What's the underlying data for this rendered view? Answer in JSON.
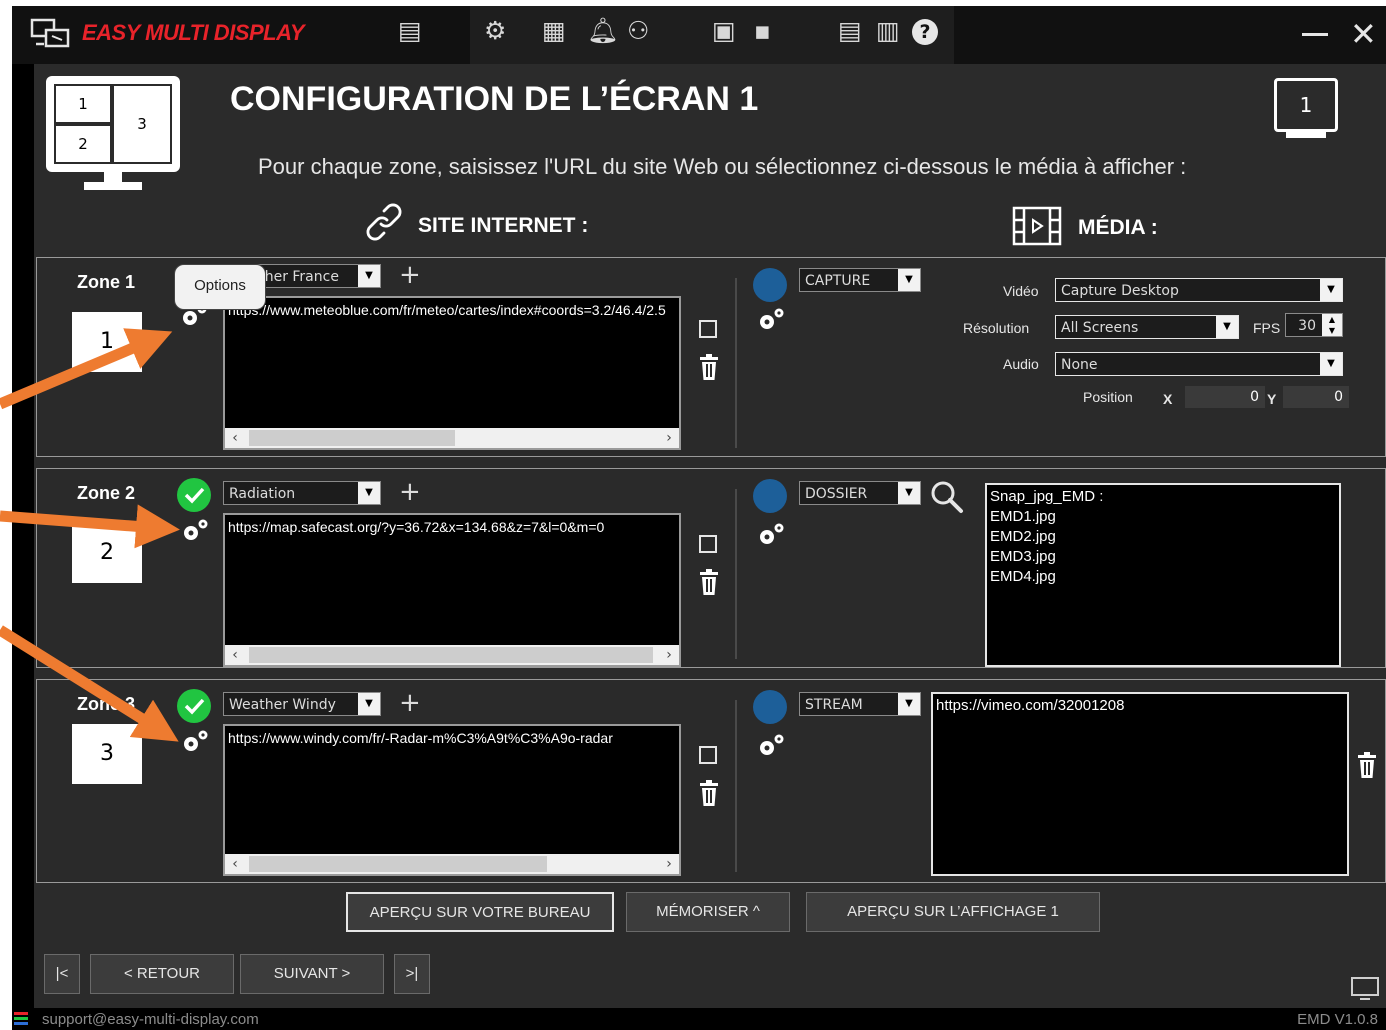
{
  "app": {
    "title": "EASY MULTI DISPLAY"
  },
  "colors": {
    "accent_red": "#e8232a",
    "circle_blue": "#1d5f99",
    "check_green": "#21c541",
    "arrow_orange": "#ee7b30"
  },
  "page": {
    "title": "CONFIGURATION DE L’ÉCRAN 1",
    "subtitle": "Pour chaque zone, saisissez l'URL du site Web ou sélectionnez ci-dessous le média à afficher :",
    "site_header": "SITE INTERNET :",
    "media_header": "MÉDIA :",
    "screen_number": "1",
    "layout_cells": [
      "1",
      "2",
      "3"
    ]
  },
  "tooltip": {
    "text": "Options"
  },
  "zones": [
    {
      "label": "Zone 1",
      "number": "1",
      "preset": "Weather France",
      "url": "https://www.meteoblue.com/fr/meteo/cartes/index#coords=3.2/46.4/2.5",
      "media_type": "CAPTURE",
      "video_label": "Vidéo",
      "video_value": "Capture Desktop",
      "resolution_label": "Résolution",
      "resolution_value": "All Screens",
      "fps_label": "FPS",
      "fps_value": "30",
      "audio_label": "Audio",
      "audio_value": "None",
      "position_label": "Position",
      "x_label": "X",
      "x_value": "0",
      "y_label": "Y",
      "y_value": "0"
    },
    {
      "label": "Zone 2",
      "number": "2",
      "preset": "Radiation",
      "url": "https://map.safecast.org/?y=36.72&x=134.68&z=7&l=0&m=0",
      "media_type": "DOSSIER",
      "media_list": [
        "Snap_jpg_EMD :",
        "EMD1.jpg",
        "EMD2.jpg",
        "EMD3.jpg",
        "EMD4.jpg"
      ]
    },
    {
      "label": "Zone 3",
      "number": "3",
      "preset": "Weather Windy",
      "url": "https://www.windy.com/fr/-Radar-m%C3%A9t%C3%A9o-radar",
      "media_type": "STREAM",
      "stream_url": "https://vimeo.com/32001208"
    }
  ],
  "buttons": {
    "preview_desktop": "APERÇU SUR VOTRE BUREAU",
    "memorize": "MÉMORISER ^",
    "preview_display": "APERÇU SUR L’AFFICHAGE 1",
    "first": "|<",
    "back": "< RETOUR",
    "next": "SUIVANT >",
    "last": ">|"
  },
  "footer": {
    "email": "support@easy-multi-display.com",
    "version": "EMD V1.0.8"
  }
}
